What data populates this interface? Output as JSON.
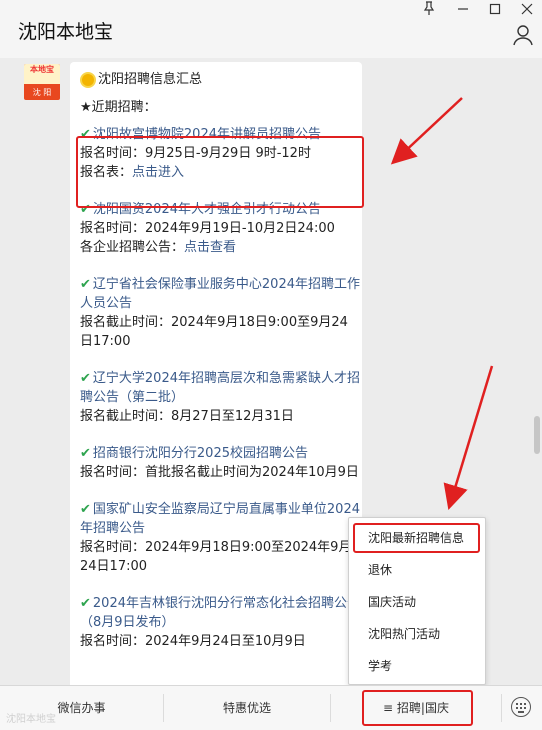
{
  "window": {
    "title": "沈阳本地宝",
    "pin_icon": "pin-icon",
    "minimize_icon": "minimize-icon",
    "maximize_icon": "maximize-icon",
    "close_icon": "close-icon",
    "user_icon": "user-icon"
  },
  "avatar": {
    "top_text": "本地宝",
    "bottom_text": "沈 阳"
  },
  "message": {
    "header": "沈阳招聘信息汇总",
    "recent_label": "★近期招聘：",
    "items": [
      {
        "title": "沈阳故宫博物院2024年讲解员招聘公告",
        "line1": "报名时间：9月25日-9月29日 9时-12时",
        "line2_label": "报名表：",
        "line2_link": "点击进入"
      },
      {
        "title": "沈阳国资2024年人才强企引才行动公告",
        "line1": "报名时间：2024年9月19日-10月2日24:00",
        "line2_label": "各企业招聘公告：",
        "line2_link": "点击查看"
      },
      {
        "title": "辽宁省社会保险事业服务中心2024年招聘工作人员公告",
        "line1": "报名截止时间：2024年9月18日9:00至9月24日17:00"
      },
      {
        "title": "辽宁大学2024年招聘高层次和急需紧缺人才招聘公告（第二批）",
        "line1": "报名截止时间：8月27日至12月31日"
      },
      {
        "title": "招商银行沈阳分行2025校园招聘公告",
        "line1": "报名时间：首批报名截止时间为2024年10月9日"
      },
      {
        "title": "国家矿山安全监察局辽宁局直属事业单位2024年招聘公告",
        "line1": "报名时间：2024年9月18日9:00至2024年9月24日17:00"
      },
      {
        "title": "2024年吉林银行沈阳分行常态化社会招聘公告（8月9日发布）",
        "line1": "报名时间：2024年9月24日至10月9日"
      }
    ]
  },
  "popup_menu": {
    "items": [
      "沈阳最新招聘信息",
      "退休",
      "国庆活动",
      "沈阳热门活动",
      "学考"
    ]
  },
  "bottom_menu": {
    "tabs": [
      "微信办事",
      "特惠优选",
      "≡ 招聘|国庆"
    ],
    "keyboard_icon": "keyboard-icon"
  },
  "watermark": "沈阳本地宝",
  "colors": {
    "highlight": "#e02020",
    "link": "#3a5a8a",
    "check": "#2ea44f"
  }
}
